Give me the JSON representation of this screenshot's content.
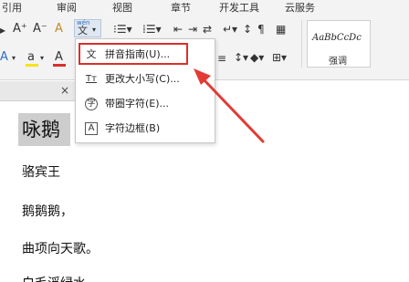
{
  "menubar": {
    "items": [
      "引用",
      "审阅",
      "视图",
      "章节",
      "开发工具",
      "云服务"
    ]
  },
  "toolbar": {
    "font_increase": "A⁺",
    "font_decrease": "A⁻",
    "clear_format": "A",
    "pinyin_button_top": "wén",
    "pinyin_button_main": "文",
    "text_effect": "A",
    "highlight": "a",
    "font_color": "A"
  },
  "style_gallery": {
    "preview": "AaBbCcDc",
    "name": "强调"
  },
  "dropdown": {
    "items": [
      {
        "icon": "文",
        "label": "拼音指南(U)..."
      },
      {
        "icon": "Tт",
        "label": "更改大小写(C)..."
      },
      {
        "icon": "字",
        "label": "带圈字符(E)..."
      },
      {
        "icon": "A",
        "label": "字符边框(B)"
      }
    ]
  },
  "tab": {
    "close": "×"
  },
  "document": {
    "title": "咏鹅",
    "lines": [
      "骆宾王",
      "鹅鹅鹅，",
      "曲项向天歌。",
      "白毛浮绿水"
    ]
  },
  "colors": {
    "highlight_box": "#d9302c",
    "arrow": "#e23b35",
    "text_effect": "#2f6fc0",
    "highlight_yellow": "#f7e21a",
    "font_color_red": "#d9302c"
  }
}
